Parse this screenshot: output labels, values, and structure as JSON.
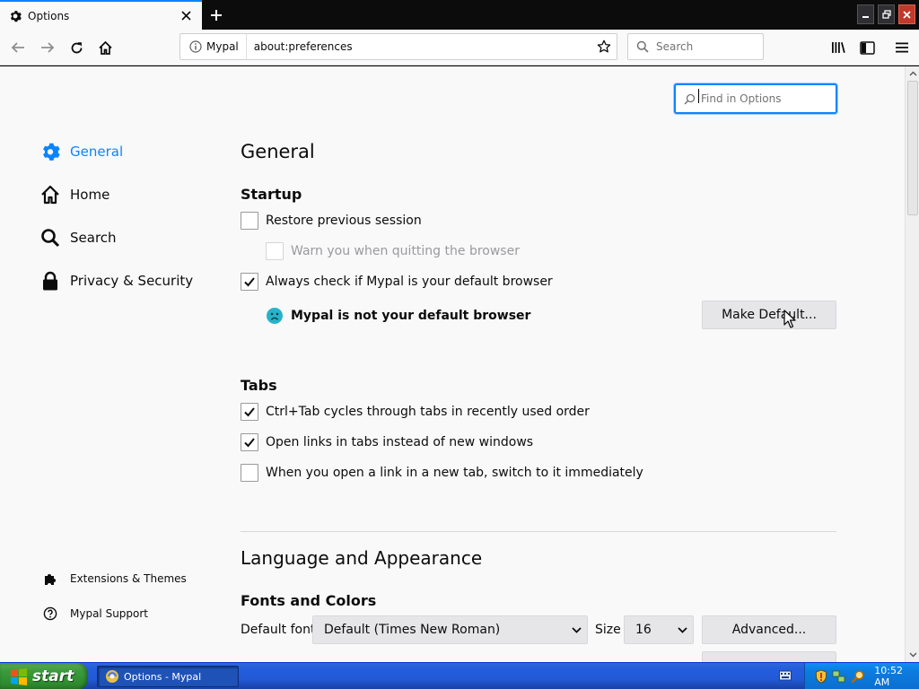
{
  "browser": {
    "tab_title": "Options",
    "identity_label": "Mypal",
    "url": "about:preferences",
    "search_placeholder": "Search"
  },
  "prefs": {
    "find_placeholder": "Find in Options",
    "categories": [
      {
        "label": "General",
        "icon": "gear-icon",
        "selected": true
      },
      {
        "label": "Home",
        "icon": "home-icon",
        "selected": false
      },
      {
        "label": "Search",
        "icon": "search-icon",
        "selected": false
      },
      {
        "label": "Privacy & Security",
        "icon": "lock-icon",
        "selected": false
      }
    ],
    "footer_links": [
      {
        "label": "Extensions & Themes",
        "icon": "puzzle-icon"
      },
      {
        "label": "Mypal Support",
        "icon": "help-icon"
      }
    ],
    "page_title": "General",
    "startup": {
      "heading": "Startup",
      "restore_session": {
        "label": "Restore previous session",
        "checked": false
      },
      "warn_quit": {
        "label": "Warn you when quitting the browser",
        "checked": false,
        "disabled": true
      },
      "check_default": {
        "label": "Always check if Mypal is your default browser",
        "checked": true
      },
      "default_notice": "Mypal is not your default browser",
      "make_default_button": "Make Default..."
    },
    "tabs": {
      "heading": "Tabs",
      "ctrl_tab": {
        "label": "Ctrl+Tab cycles through tabs in recently used order",
        "checked": true
      },
      "open_links": {
        "label": "Open links in tabs instead of new windows",
        "checked": true
      },
      "switch_tab": {
        "label": "When you open a link in a new tab, switch to it immediately",
        "checked": false
      }
    },
    "language": {
      "heading": "Language and Appearance",
      "fonts_heading": "Fonts and Colors",
      "default_font_label": "Default font",
      "default_font_value": "Default (Times New Roman)",
      "size_label": "Size",
      "size_value": "16",
      "advanced_button": "Advanced..."
    }
  },
  "taskbar": {
    "start_label": "start",
    "task_item": "Options - Mypal",
    "clock": "10:52 AM"
  },
  "colors": {
    "accent": "#0a84ff",
    "page_bg": "#f9f9fa"
  }
}
